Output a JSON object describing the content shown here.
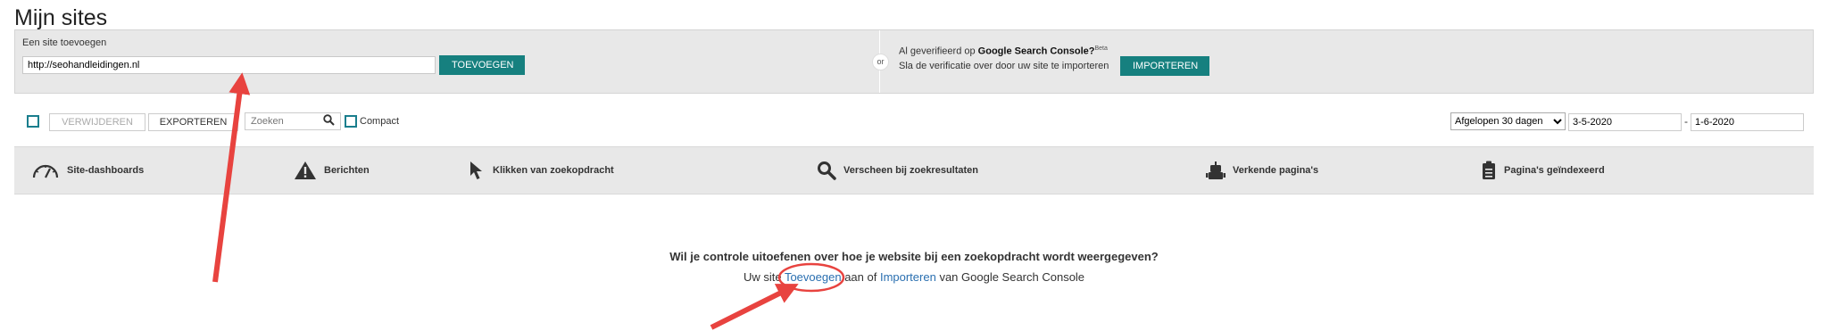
{
  "page": {
    "title": "Mijn sites"
  },
  "add_site": {
    "label": "Een site toevoegen",
    "url_value": "http://seohandleidingen.nl",
    "button": "TOEVOEGEN"
  },
  "import": {
    "or": "or",
    "line1_prefix": "Al geverifieerd op ",
    "line1_brand": "Google Search Console?",
    "beta": "Beta",
    "line2": "Sla de verificatie over door uw site te importeren",
    "button": "IMPORTEREN"
  },
  "toolbar": {
    "delete": "VERWIJDEREN",
    "export": "EXPORTEREN",
    "search_placeholder": "Zoeken",
    "compact": "Compact",
    "period": "Afgelopen 30 dagen",
    "date_from": "3-5-2020",
    "date_to": "1-6-2020",
    "separator": "-"
  },
  "metrics": [
    {
      "label": "Site-dashboards",
      "icon": "gauge-icon"
    },
    {
      "label": "Berichten",
      "icon": "warning-icon"
    },
    {
      "label": "Klikken van zoekopdracht",
      "icon": "cursor-icon"
    },
    {
      "label": "Verscheen bij zoekresultaten",
      "icon": "magnifier-icon"
    },
    {
      "label": "Verkende pagina's",
      "icon": "robot-icon"
    },
    {
      "label": "Pagina's geïndexeerd",
      "icon": "clipboard-icon"
    }
  ],
  "cta": {
    "question": "Wil je controle uitoefenen over hoe je website bij een zoekopdracht wordt weergegeven?",
    "prefix": "Uw site ",
    "add_link": "Toevoegen",
    "middle": " aan of ",
    "import_link": "Importeren",
    "suffix": " van Google Search Console"
  },
  "colors": {
    "accent": "#16807f",
    "link": "#2a6fb0",
    "annotation": "#e8433f"
  }
}
